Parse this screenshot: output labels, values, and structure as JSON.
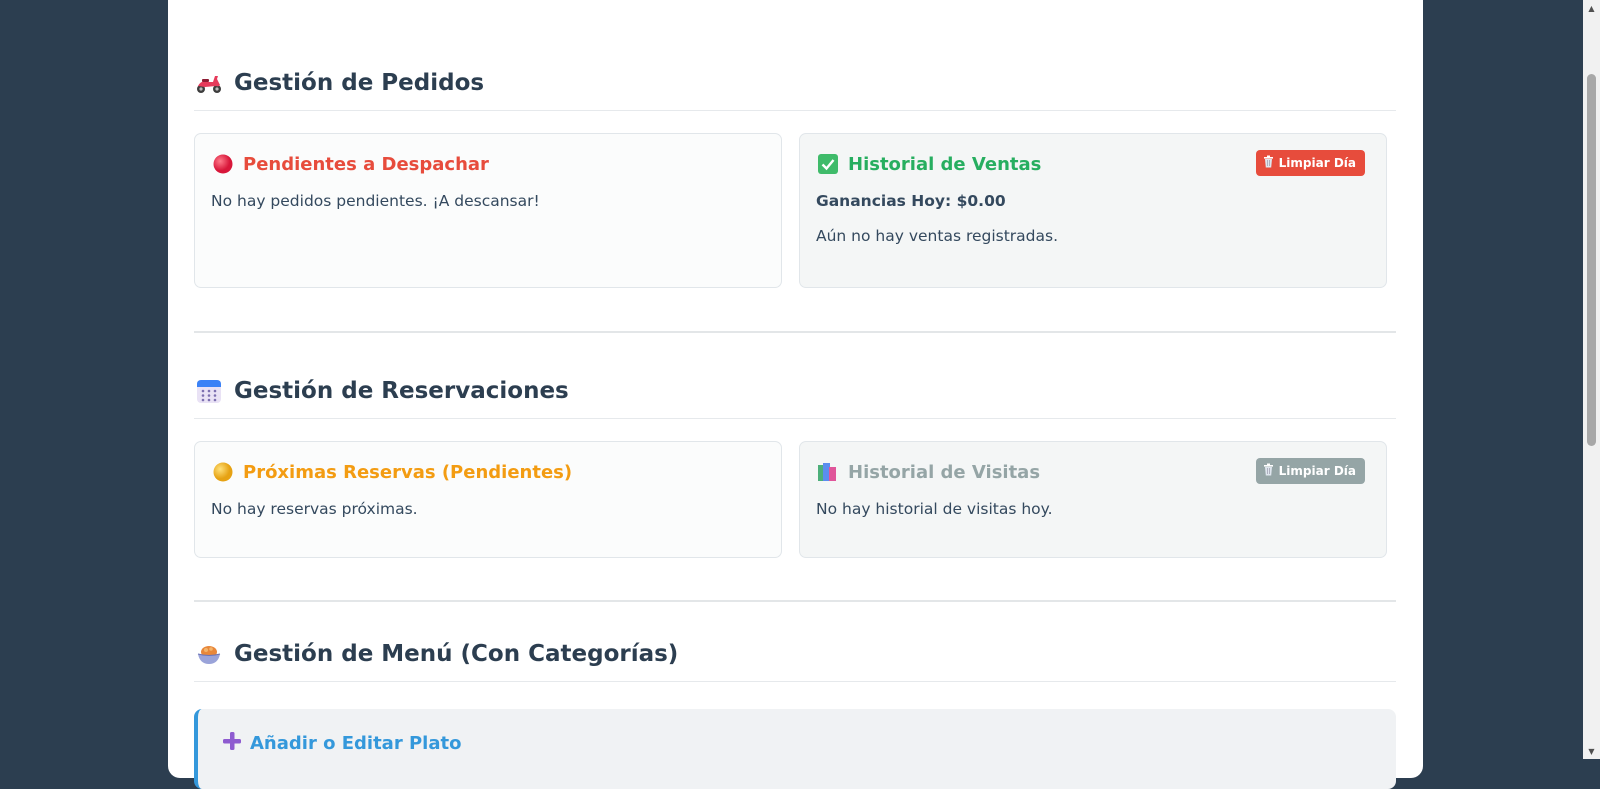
{
  "orders": {
    "title": "Gestión de Pedidos",
    "pending": {
      "title": "Pendientes a Despachar",
      "empty_text": "No hay pedidos pendientes. ¡A descansar!"
    },
    "sales": {
      "title": "Historial de Ventas",
      "clear_label": "Limpiar Día",
      "earnings": "Ganancias Hoy: $0.00",
      "empty_text": "Aún no hay ventas registradas."
    }
  },
  "reservations": {
    "title": "Gestión de Reservaciones",
    "upcoming": {
      "title": "Próximas Reservas (Pendientes)",
      "empty_text": "No hay reservas próximas."
    },
    "visits": {
      "title": "Historial de Visitas",
      "clear_label": "Limpiar Día",
      "empty_text": "No hay historial de visitas hoy."
    }
  },
  "menu": {
    "title": "Gestión de Menú (Con Categorías)",
    "add_edit": {
      "title": "Añadir o Editar Plato"
    }
  },
  "colors": {
    "page_bg": "#2c3e50",
    "pending_red": "#e74c3c",
    "sales_green": "#27ae60",
    "upcoming_orange": "#f39c12",
    "visits_grey": "#95a5a6",
    "accent_blue": "#3498db"
  },
  "icons": {
    "orders": "scooter-icon",
    "pending": "red-circle-icon",
    "sales": "check-mark-icon",
    "clear": "trash-icon",
    "reservations": "calendar-icon",
    "upcoming": "yellow-circle-icon",
    "visits": "books-icon",
    "menu": "food-bowl-icon",
    "add": "plus-icon"
  }
}
